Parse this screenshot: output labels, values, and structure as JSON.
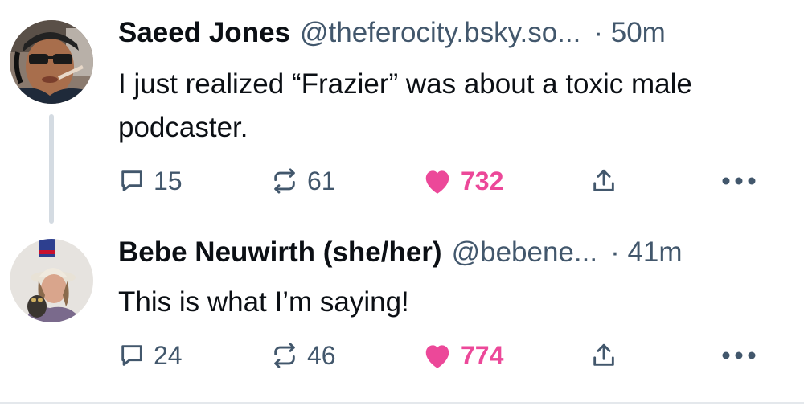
{
  "posts": [
    {
      "author_name": "Saeed Jones",
      "handle": "@theferocity.bsky.so...",
      "time": "· 50m",
      "text": "I just realized “Frazier” was about a toxic male podcaster.",
      "replies": "15",
      "reposts": "61",
      "likes": "732",
      "liked": true
    },
    {
      "author_name": "Bebe Neuwirth (she/her)",
      "handle": "@bebene...",
      "time": "· 41m",
      "text": "This is what I’m saying!",
      "replies": "24",
      "reposts": "46",
      "likes": "774",
      "liked": true
    }
  ],
  "colors": {
    "like": "#ec4899",
    "muted": "#42576c",
    "thread_line": "#d4dbe2"
  },
  "icons": [
    "reply-icon",
    "repost-icon",
    "heart-icon",
    "share-icon",
    "more-icon"
  ]
}
